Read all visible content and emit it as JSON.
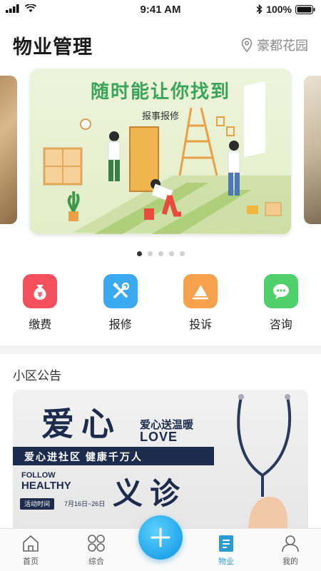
{
  "status_bar": {
    "time": "9:41 AM",
    "battery": "100%"
  },
  "header": {
    "title": "物业管理",
    "location": "豪都花园"
  },
  "banner": {
    "title": "随时能让你找到",
    "subtitle": "报事报修",
    "dot_count": 5,
    "active_dot": 0
  },
  "quick_actions": [
    {
      "label": "缴费",
      "icon": "payment-bag-icon",
      "color": "#f4505e"
    },
    {
      "label": "报修",
      "icon": "repair-tools-icon",
      "color": "#3aa9ef"
    },
    {
      "label": "投诉",
      "icon": "complaint-icon",
      "color": "#f7a14d"
    },
    {
      "label": "咨询",
      "icon": "chat-bubble-icon",
      "color": "#4fd06a"
    }
  ],
  "notice": {
    "section_title": "小区公告",
    "poster": {
      "headline_top": "爱心",
      "tagline": "爱心送温暖",
      "tagline_en": "LOVE",
      "band": "爱心进社区   健康千万人",
      "follow": "FOLLOW",
      "healthy": "HEALTHY",
      "headline_bottom": "义诊",
      "date_label": "活动时间",
      "date_range": "7月16日~26日"
    }
  },
  "tabbar": {
    "tabs": [
      {
        "label": "首页",
        "icon": "home-icon",
        "active": false
      },
      {
        "label": "综合",
        "icon": "grid-icon",
        "active": false
      },
      {
        "label": "物业",
        "icon": "document-icon",
        "active": true
      },
      {
        "label": "我的",
        "icon": "profile-icon",
        "active": false
      }
    ],
    "accent": "#2b9bd6"
  }
}
